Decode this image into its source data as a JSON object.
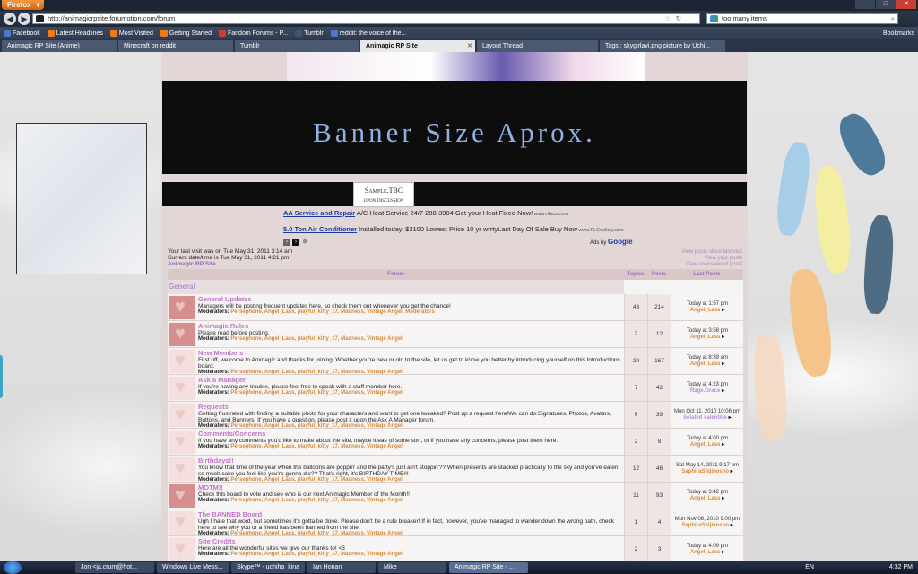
{
  "browser": {
    "app_button": "Firefox",
    "url": "http://animagicrpsite.forumotion.com/forum",
    "search_value": "too many items",
    "bookmarks": [
      "Facebook",
      "Latest Headlines",
      "Most Visited",
      "Getting Started",
      "Fandom Forums - P...",
      "Tumblr",
      "reddit: the voice of the..."
    ],
    "bookmarks_right": "Bookmarks",
    "tabs": [
      {
        "label": "Animagic RP Site (Anime)",
        "active": false
      },
      {
        "label": "Minecraft on reddit",
        "active": false
      },
      {
        "label": "Tumblr",
        "active": false
      },
      {
        "label": "Animagic RP Site",
        "active": true
      },
      {
        "label": "Layout Thread",
        "active": false
      },
      {
        "label": "Tags : skygirlavi.png picture by Uchi...",
        "active": false
      }
    ]
  },
  "page": {
    "banner_text": "Banner Size Aprox.",
    "sample_line1": "Sample.TBC",
    "sample_line2": "upon discussion",
    "ad1": {
      "link": "AA Service and Repair",
      "text": " A/C Heat Service 24/7 288-3904 Get your Heat Fixed Now!",
      "small": " www.rlfacs.com"
    },
    "ad2": {
      "link": "5.0 Ton Air Conditioner",
      "text": " Installed today. $3100 Lowest Price 10 yr wrrtyLast Day Of Sale Buy Now",
      "small": " www.FLCooling.com"
    },
    "ads_by": "Ads by",
    "ads_google": "Google",
    "last_visit": "Your last visit was on Tue May 31, 2011 3:14 am",
    "current_date": "Current date/time is Tue May 31, 2011 4:21 pm",
    "site_link": "Animagic RP Site",
    "top_links": [
      "View posts since last visit",
      "View your posts",
      "View unanswered posts"
    ],
    "table_headers": {
      "forum": "Forum",
      "topics": "Topics",
      "posts": "Posts",
      "last_post": "Last Posts"
    },
    "category": "General",
    "mod_label": "Moderators:",
    "forums": [
      {
        "title": "General Updates",
        "desc": "Managers will be posting frequent updates here, so check them out whenever you get the chance!",
        "mods": "Persephone, Angel_Lass, playful_kitty_17, Madness, Vintage Angel, Moderators",
        "topics": "43",
        "posts": "214",
        "last_date": "Today at 1:57 pm",
        "last_user": "Angel_Lass",
        "pale": false
      },
      {
        "title": "Animagic Rules",
        "desc": "Please read before posting.",
        "mods": "Persephone, Angel_Lass, playful_kitty_17, Madness, Vintage Angel",
        "topics": "2",
        "posts": "12",
        "last_date": "Today at 3:58 pm",
        "last_user": "Angel_Lass",
        "pale": false
      },
      {
        "title": "New Members",
        "desc": "First off, welcome to Animagic and thanks for joining! Whether you're new or old to the site, let us get to know you better by introducing yourself on this Introductions board.",
        "mods": "Persephone, Angel_Lass, playful_kitty_17, Madness, Vintage Angel",
        "topics": "29",
        "posts": "167",
        "last_date": "Today at 8:39 am",
        "last_user": "Angel_Lass",
        "pale": true
      },
      {
        "title": "Ask a Manager",
        "desc": "If you're having any trouble, please feel free to speak with a staff member here.",
        "mods": "Persephone, Angel_Lass, playful_kitty_17, Madness, Vintage Angel",
        "topics": "7",
        "posts": "42",
        "last_date": "Today at 4:23 pm",
        "last_user": "Rage.Grace",
        "pale": true
      },
      {
        "title": "Requests",
        "desc": "Getting frustrated with finding a suitable photo for your characters and want to get one tweaked? Post up a request here!We can do:Signatures, Photos, Avatars, Buttons, and Banners. If you have a question, please post it upon the Ask A Manager forum.",
        "mods": "Persephone, Angel_Lass, playful_kitty_17, Madness, Vintage Angel",
        "topics": "6",
        "posts": "39",
        "last_date": "Mon Oct 11, 2010 10:06 pm",
        "last_user": "belated valentine",
        "pale": true
      },
      {
        "title": "Comments/Concerns",
        "desc": "If you have any comments you'd like to make about the site, maybe ideas of some sort, or if you have any concerns, please post them here.",
        "mods": "Persephone, Angel_Lass, playful_kitty_17, Madness, Vintage Angel",
        "topics": "2",
        "posts": "8",
        "last_date": "Today at 4:00 pm",
        "last_user": "Angel_Lass",
        "pale": true
      },
      {
        "title": "Birthdays!!",
        "desc": "You know that time of the year when the balloons are poppin' and the party's just ain't stoppin'?? When presents are stacked practically to the sky and you've eaten so much cake you feel like you're gonna die?? That's right, it's BIRTHDAY TIME!!!",
        "mods": "Persephone, Angel_Lass, playful_kitty_17, Madness, Vintage Angel",
        "topics": "12",
        "posts": "46",
        "last_date": "Sat May 14, 2011 9:17 pm",
        "last_user": "SaphiraShijinosho",
        "pale": true
      },
      {
        "title": "MOTM!!",
        "desc": "Check this board to vote and see who is our next Animagic Member of the Month!!",
        "mods": "Persephone, Angel_Lass, playful_kitty_17, Madness, Vintage Angel",
        "topics": "11",
        "posts": "93",
        "last_date": "Today at 3:42 pm",
        "last_user": "Angel_Lass",
        "pale": false
      },
      {
        "title": "The BANNED Board",
        "desc": "Ugh I hate that word, but sometimes it's gotta be done. Please don't be a rule breaker! If in fact, however, you've managed to wander down the wrong path, check here to see why you or a friend has been banned from the site.",
        "mods": "Persephone, Angel_Lass, playful_kitty_17, Madness, Vintage Angel",
        "topics": "1",
        "posts": "4",
        "last_date": "Mon Nov 08, 2010 9:00 pm",
        "last_user": "SaphiraShijinosho",
        "pale": true
      },
      {
        "title": "Site Credits",
        "desc": "Here are all the wonderful sites we give our thanks to! <3",
        "mods": "Persephone, Angel_Lass, playful_kitty_17, Madness, Vintage Angel",
        "topics": "2",
        "posts": "3",
        "last_date": "Today at 4:09 pm",
        "last_user": "Angel_Lass",
        "pale": true
      }
    ]
  },
  "taskbar": {
    "items": [
      "Jon <ja.crum@hot...",
      "Windows Live Mess...",
      "Skype™ - uchiha_kina",
      "Ian Honan",
      "Mike",
      "Animagic RP Site - ..."
    ],
    "lang": "EN",
    "clock": "4:32 PM"
  },
  "colors": {
    "forum_title": "#c074c9",
    "username": "#d68a3a",
    "banner_text": "#8fb2e6"
  }
}
